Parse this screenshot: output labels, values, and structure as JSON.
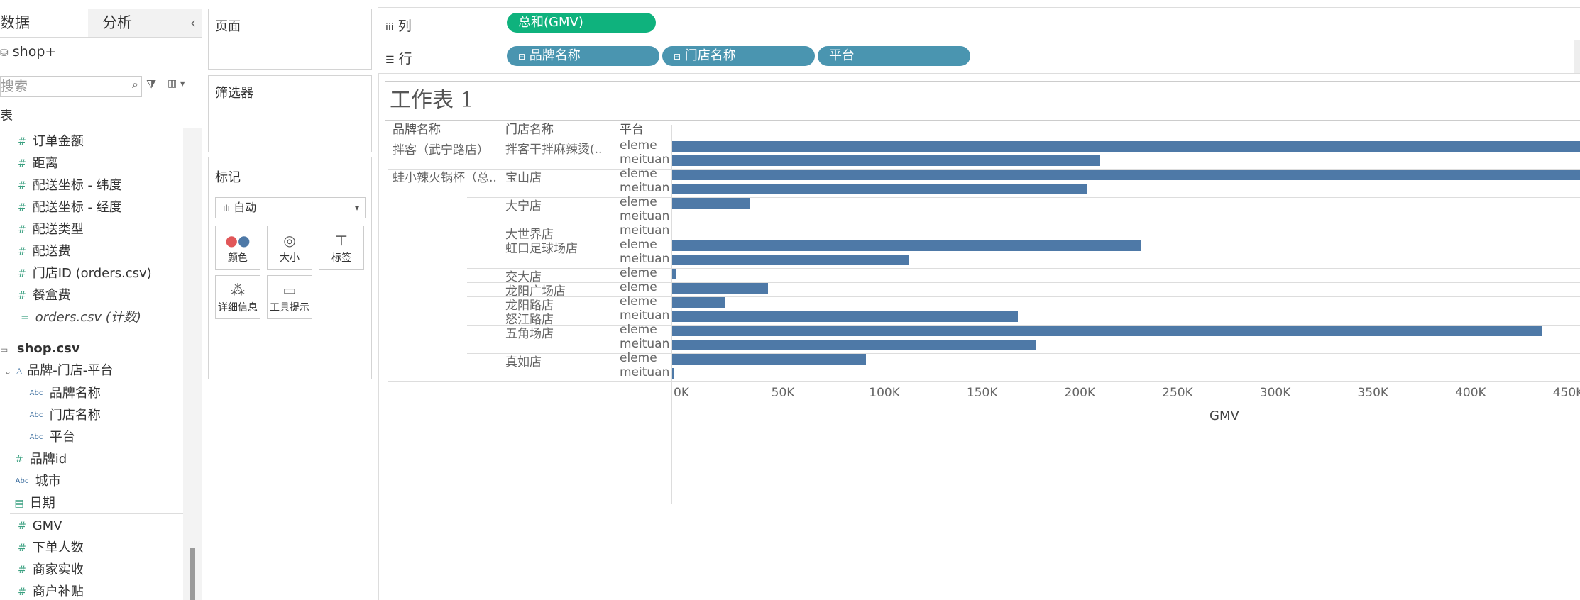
{
  "data_pane": {
    "tabs": [
      "数据",
      "分析"
    ],
    "collapse_glyph": "‹",
    "datasource": "shop+",
    "search_placeholder": "搜索",
    "section_table_label": "表",
    "orders_fields": [
      "订单金额",
      "距离",
      "配送坐标 - 纬度",
      "配送坐标 - 经度",
      "配送类型",
      "配送费",
      "门店ID (orders.csv)",
      "餐盒费"
    ],
    "orders_count": "orders.csv (计数)",
    "shop_table": "shop.csv",
    "hierarchy": "品牌-门店-平台",
    "hierarchy_children": [
      "品牌名称",
      "门店名称",
      "平台"
    ],
    "shop_fields": [
      "品牌id",
      "城市",
      "日期"
    ],
    "measures": [
      "GMV",
      "下单人数",
      "商家实收",
      "商户补贴"
    ]
  },
  "shelves": {
    "pages_label": "页面",
    "filters_label": "筛选器",
    "marks_label": "标记",
    "marks_type": "自动",
    "mark_buttons": [
      "颜色",
      "大小",
      "标签",
      "详细信息",
      "工具提示"
    ],
    "columns_label": "列",
    "rows_label": "行",
    "columns_pills": [
      "总和(GMV)"
    ],
    "rows_pills": [
      "品牌名称",
      "门店名称",
      "平台"
    ]
  },
  "view": {
    "sheet_title": "工作表 1",
    "headers": [
      "品牌名称",
      "门店名称",
      "平台"
    ],
    "brands": [
      "拌客（武宁路店）",
      "蛙小辣火锅杯（总.."
    ]
  },
  "chart_data": {
    "type": "bar",
    "orientation": "horizontal",
    "xlabel": "GMV",
    "xlim": [
      0,
      465000
    ],
    "x_ticks": [
      "0K",
      "50K",
      "100K",
      "150K",
      "200K",
      "250K",
      "300K",
      "350K",
      "400K",
      "450K"
    ],
    "rows": [
      {
        "brand": "拌客（武宁路店）",
        "store": "拌客干拌麻辣烫(..",
        "platform": "eleme",
        "value": 470000
      },
      {
        "brand": "拌客（武宁路店）",
        "store": "拌客干拌麻辣烫(..",
        "platform": "meituan",
        "value": 219000
      },
      {
        "brand": "蛙小辣火锅杯（总..",
        "store": "宝山店",
        "platform": "eleme",
        "value": 470000
      },
      {
        "brand": "蛙小辣火锅杯（总..",
        "store": "宝山店",
        "platform": "meituan",
        "value": 212000
      },
      {
        "brand": "蛙小辣火锅杯（总..",
        "store": "大宁店",
        "platform": "eleme",
        "value": 40000
      },
      {
        "brand": "蛙小辣火锅杯（总..",
        "store": "大宁店",
        "platform": "meituan",
        "value": 0
      },
      {
        "brand": "蛙小辣火锅杯（总..",
        "store": "大世界店",
        "platform": "meituan",
        "value": 0
      },
      {
        "brand": "蛙小辣火锅杯（总..",
        "store": "虹口足球场店",
        "platform": "eleme",
        "value": 240000
      },
      {
        "brand": "蛙小辣火锅杯（总..",
        "store": "虹口足球场店",
        "platform": "meituan",
        "value": 121000
      },
      {
        "brand": "蛙小辣火锅杯（总..",
        "store": "交大店",
        "platform": "eleme",
        "value": 2000
      },
      {
        "brand": "蛙小辣火锅杯（总..",
        "store": "龙阳广场店",
        "platform": "eleme",
        "value": 49000
      },
      {
        "brand": "蛙小辣火锅杯（总..",
        "store": "龙阳路店",
        "platform": "eleme",
        "value": 27000
      },
      {
        "brand": "蛙小辣火锅杯（总..",
        "store": "怒江路店",
        "platform": "meituan",
        "value": 177000
      },
      {
        "brand": "蛙小辣火锅杯（总..",
        "store": "五角场店",
        "platform": "eleme",
        "value": 445000
      },
      {
        "brand": "蛙小辣火锅杯（总..",
        "store": "五角场店",
        "platform": "meituan",
        "value": 186000
      },
      {
        "brand": "蛙小辣火锅杯（总..",
        "store": "真如店",
        "platform": "eleme",
        "value": 99000
      },
      {
        "brand": "蛙小辣火锅杯（总..",
        "store": "真如店",
        "platform": "meituan",
        "value": 1000
      }
    ],
    "color": "#4e79a7"
  }
}
